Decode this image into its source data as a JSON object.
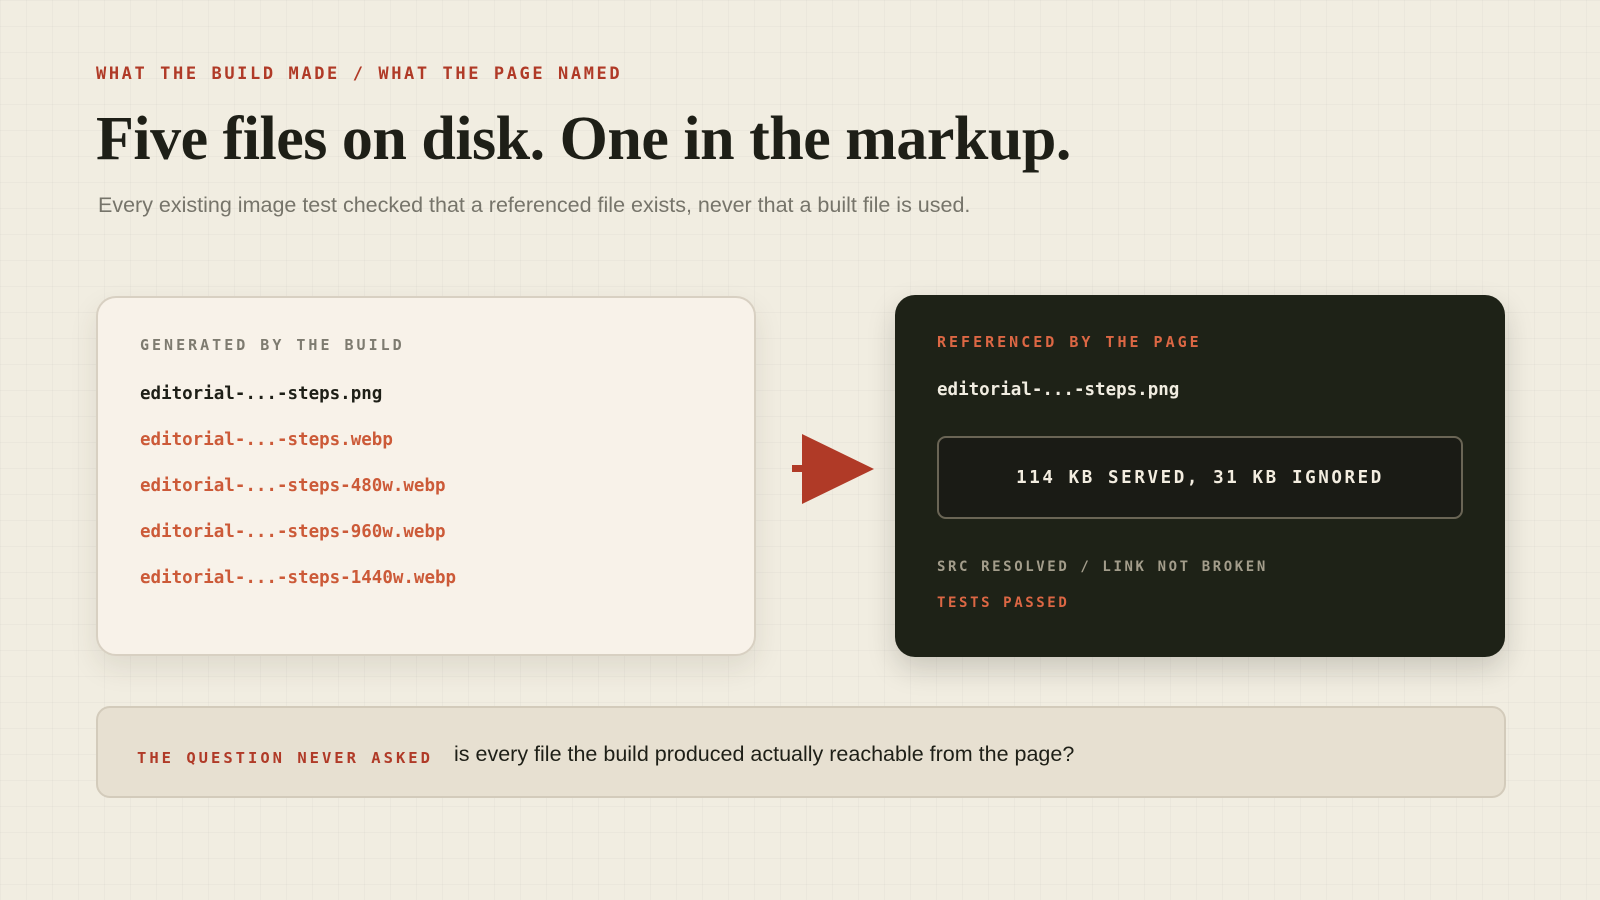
{
  "header": {
    "eyebrow": "WHAT THE BUILD MADE / WHAT THE PAGE NAMED",
    "title": "Five files on disk. One in the markup.",
    "subtitle": "Every existing image test checked that a referenced file exists, never that a built file is used."
  },
  "generated": {
    "label": "GENERATED BY THE BUILD",
    "files": [
      {
        "name": "editorial-...-steps.png",
        "referenced": true
      },
      {
        "name": "editorial-...-steps.webp",
        "referenced": false
      },
      {
        "name": "editorial-...-steps-480w.webp",
        "referenced": false
      },
      {
        "name": "editorial-...-steps-960w.webp",
        "referenced": false
      },
      {
        "name": "editorial-...-steps-1440w.webp",
        "referenced": false
      }
    ]
  },
  "referenced": {
    "label": "REFERENCED BY THE PAGE",
    "file": "editorial-...-steps.png",
    "summary": "114 KB SERVED, 31 KB IGNORED",
    "status_line": "SRC RESOLVED / LINK NOT BROKEN",
    "result": "TESTS PASSED"
  },
  "arrow_icon": "right-arrow-icon",
  "callout": {
    "label": "THE QUESTION NEVER ASKED",
    "text": "is every file the build produced actually reachable from the page?"
  },
  "colors": {
    "accent": "#b03a27",
    "accent_light": "#dc6744",
    "background": "#f1ede1",
    "dark_panel": "#1e2217",
    "light_panel": "#f8f2e9"
  }
}
